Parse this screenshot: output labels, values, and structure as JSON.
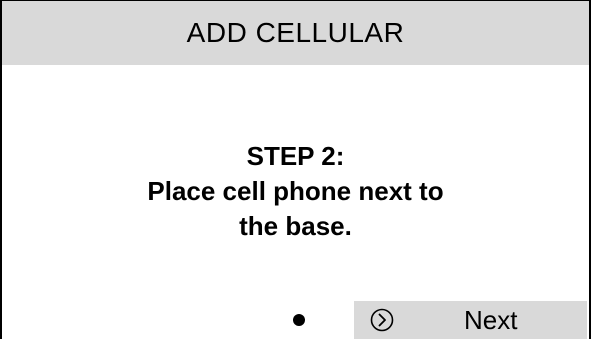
{
  "screen": {
    "title": "ADD CELLULAR"
  },
  "message": {
    "step": "STEP 2:",
    "line1": "Place cell phone next to",
    "line2": "the base."
  },
  "softkey": {
    "next_label": "Next",
    "icon": "circle-chevron-right-icon"
  },
  "colors": {
    "bar_background": "#d9d9d9",
    "text": "#000000",
    "background": "#ffffff"
  }
}
